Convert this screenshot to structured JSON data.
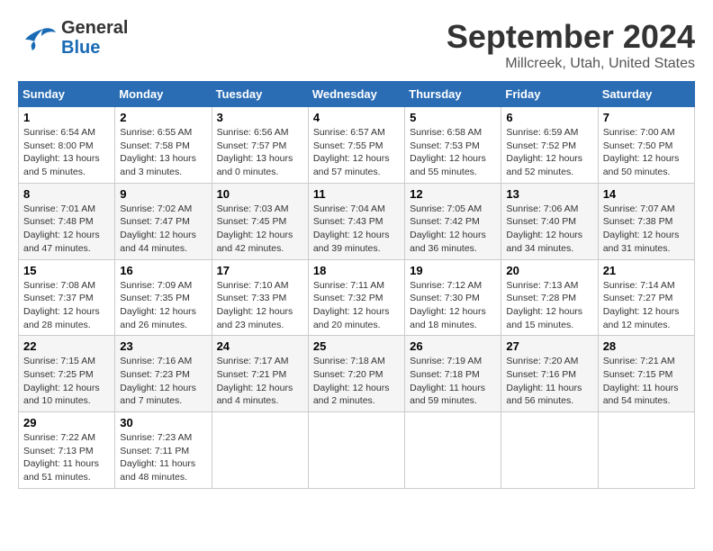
{
  "header": {
    "logo": {
      "text_general": "General",
      "text_blue": "Blue"
    },
    "month": "September 2024",
    "location": "Millcreek, Utah, United States"
  },
  "columns": [
    "Sunday",
    "Monday",
    "Tuesday",
    "Wednesday",
    "Thursday",
    "Friday",
    "Saturday"
  ],
  "weeks": [
    [
      {
        "day": "1",
        "sunrise": "Sunrise: 6:54 AM",
        "sunset": "Sunset: 8:00 PM",
        "daylight": "Daylight: 13 hours and 5 minutes."
      },
      {
        "day": "2",
        "sunrise": "Sunrise: 6:55 AM",
        "sunset": "Sunset: 7:58 PM",
        "daylight": "Daylight: 13 hours and 3 minutes."
      },
      {
        "day": "3",
        "sunrise": "Sunrise: 6:56 AM",
        "sunset": "Sunset: 7:57 PM",
        "daylight": "Daylight: 13 hours and 0 minutes."
      },
      {
        "day": "4",
        "sunrise": "Sunrise: 6:57 AM",
        "sunset": "Sunset: 7:55 PM",
        "daylight": "Daylight: 12 hours and 57 minutes."
      },
      {
        "day": "5",
        "sunrise": "Sunrise: 6:58 AM",
        "sunset": "Sunset: 7:53 PM",
        "daylight": "Daylight: 12 hours and 55 minutes."
      },
      {
        "day": "6",
        "sunrise": "Sunrise: 6:59 AM",
        "sunset": "Sunset: 7:52 PM",
        "daylight": "Daylight: 12 hours and 52 minutes."
      },
      {
        "day": "7",
        "sunrise": "Sunrise: 7:00 AM",
        "sunset": "Sunset: 7:50 PM",
        "daylight": "Daylight: 12 hours and 50 minutes."
      }
    ],
    [
      {
        "day": "8",
        "sunrise": "Sunrise: 7:01 AM",
        "sunset": "Sunset: 7:48 PM",
        "daylight": "Daylight: 12 hours and 47 minutes."
      },
      {
        "day": "9",
        "sunrise": "Sunrise: 7:02 AM",
        "sunset": "Sunset: 7:47 PM",
        "daylight": "Daylight: 12 hours and 44 minutes."
      },
      {
        "day": "10",
        "sunrise": "Sunrise: 7:03 AM",
        "sunset": "Sunset: 7:45 PM",
        "daylight": "Daylight: 12 hours and 42 minutes."
      },
      {
        "day": "11",
        "sunrise": "Sunrise: 7:04 AM",
        "sunset": "Sunset: 7:43 PM",
        "daylight": "Daylight: 12 hours and 39 minutes."
      },
      {
        "day": "12",
        "sunrise": "Sunrise: 7:05 AM",
        "sunset": "Sunset: 7:42 PM",
        "daylight": "Daylight: 12 hours and 36 minutes."
      },
      {
        "day": "13",
        "sunrise": "Sunrise: 7:06 AM",
        "sunset": "Sunset: 7:40 PM",
        "daylight": "Daylight: 12 hours and 34 minutes."
      },
      {
        "day": "14",
        "sunrise": "Sunrise: 7:07 AM",
        "sunset": "Sunset: 7:38 PM",
        "daylight": "Daylight: 12 hours and 31 minutes."
      }
    ],
    [
      {
        "day": "15",
        "sunrise": "Sunrise: 7:08 AM",
        "sunset": "Sunset: 7:37 PM",
        "daylight": "Daylight: 12 hours and 28 minutes."
      },
      {
        "day": "16",
        "sunrise": "Sunrise: 7:09 AM",
        "sunset": "Sunset: 7:35 PM",
        "daylight": "Daylight: 12 hours and 26 minutes."
      },
      {
        "day": "17",
        "sunrise": "Sunrise: 7:10 AM",
        "sunset": "Sunset: 7:33 PM",
        "daylight": "Daylight: 12 hours and 23 minutes."
      },
      {
        "day": "18",
        "sunrise": "Sunrise: 7:11 AM",
        "sunset": "Sunset: 7:32 PM",
        "daylight": "Daylight: 12 hours and 20 minutes."
      },
      {
        "day": "19",
        "sunrise": "Sunrise: 7:12 AM",
        "sunset": "Sunset: 7:30 PM",
        "daylight": "Daylight: 12 hours and 18 minutes."
      },
      {
        "day": "20",
        "sunrise": "Sunrise: 7:13 AM",
        "sunset": "Sunset: 7:28 PM",
        "daylight": "Daylight: 12 hours and 15 minutes."
      },
      {
        "day": "21",
        "sunrise": "Sunrise: 7:14 AM",
        "sunset": "Sunset: 7:27 PM",
        "daylight": "Daylight: 12 hours and 12 minutes."
      }
    ],
    [
      {
        "day": "22",
        "sunrise": "Sunrise: 7:15 AM",
        "sunset": "Sunset: 7:25 PM",
        "daylight": "Daylight: 12 hours and 10 minutes."
      },
      {
        "day": "23",
        "sunrise": "Sunrise: 7:16 AM",
        "sunset": "Sunset: 7:23 PM",
        "daylight": "Daylight: 12 hours and 7 minutes."
      },
      {
        "day": "24",
        "sunrise": "Sunrise: 7:17 AM",
        "sunset": "Sunset: 7:21 PM",
        "daylight": "Daylight: 12 hours and 4 minutes."
      },
      {
        "day": "25",
        "sunrise": "Sunrise: 7:18 AM",
        "sunset": "Sunset: 7:20 PM",
        "daylight": "Daylight: 12 hours and 2 minutes."
      },
      {
        "day": "26",
        "sunrise": "Sunrise: 7:19 AM",
        "sunset": "Sunset: 7:18 PM",
        "daylight": "Daylight: 11 hours and 59 minutes."
      },
      {
        "day": "27",
        "sunrise": "Sunrise: 7:20 AM",
        "sunset": "Sunset: 7:16 PM",
        "daylight": "Daylight: 11 hours and 56 minutes."
      },
      {
        "day": "28",
        "sunrise": "Sunrise: 7:21 AM",
        "sunset": "Sunset: 7:15 PM",
        "daylight": "Daylight: 11 hours and 54 minutes."
      }
    ],
    [
      {
        "day": "29",
        "sunrise": "Sunrise: 7:22 AM",
        "sunset": "Sunset: 7:13 PM",
        "daylight": "Daylight: 11 hours and 51 minutes."
      },
      {
        "day": "30",
        "sunrise": "Sunrise: 7:23 AM",
        "sunset": "Sunset: 7:11 PM",
        "daylight": "Daylight: 11 hours and 48 minutes."
      },
      null,
      null,
      null,
      null,
      null
    ]
  ]
}
